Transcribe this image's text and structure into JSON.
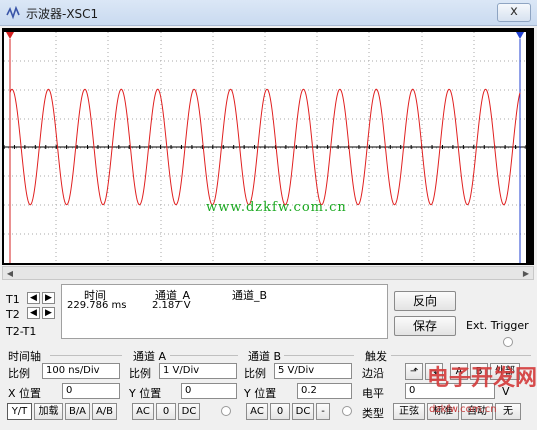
{
  "window": {
    "title": "示波器-XSC1",
    "close_label": "x"
  },
  "scope": {
    "trace_color": "#e02020",
    "grid_color": "#aaaaaa",
    "axis_color": "#000000",
    "cycles_visible": 14,
    "amplitude_divisions": 1.6
  },
  "watermark": {
    "text": "www.dzkfw.com.cn",
    "color": "#19a81f"
  },
  "logo_watermark": {
    "text": "电子开发网",
    "url": "dzkfw.com.cn"
  },
  "cursors": {
    "t1": "T1",
    "t2": "T2",
    "t2_t1": "T2-T1"
  },
  "readout": {
    "headers": {
      "time": "时间",
      "channel_a": "通道_A",
      "channel_b": "通道_B"
    },
    "t1_row": {
      "time": "229.786 ms",
      "channel_a": "2.187 V",
      "channel_b": ""
    }
  },
  "buttons": {
    "reverse": "反向",
    "save": "保存",
    "ext_trigger": "Ext. Trigger"
  },
  "timebase": {
    "title": "时间轴",
    "scale_label": "比例",
    "scale_value": "100 ns/Div",
    "pos_label": "X 位置",
    "pos_value": "0",
    "modes": [
      "Y/T",
      "加载",
      "B/A",
      "A/B"
    ]
  },
  "channel_a": {
    "title": "通道 A",
    "scale_label": "比例",
    "scale_value": "1  V/Div",
    "pos_label": "Y 位置",
    "pos_value": "0",
    "coupling": [
      "AC",
      "0",
      "DC"
    ]
  },
  "channel_b": {
    "title": "通道 B",
    "scale_label": "比例",
    "scale_value": "5  V/Div",
    "pos_label": "Y 位置",
    "pos_value": "0.2",
    "coupling": [
      "AC",
      "0",
      "DC",
      "-"
    ]
  },
  "trigger": {
    "title": "触发",
    "edge_label": "边沿",
    "level_label": "电平",
    "level_value": "0",
    "level_unit": "V",
    "sources": [
      "A",
      "B",
      "外部"
    ],
    "type_label": "类型",
    "types": [
      "正弦",
      "标准",
      "自动",
      "无"
    ]
  }
}
